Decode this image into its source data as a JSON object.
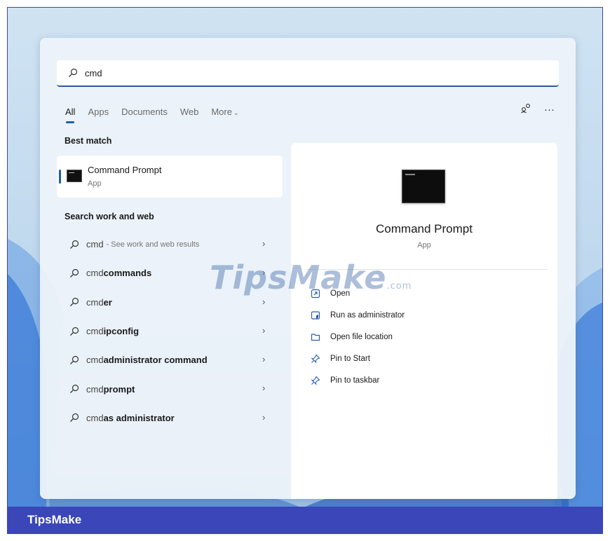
{
  "search": {
    "query": "cmd"
  },
  "tabs": [
    {
      "label": "All"
    },
    {
      "label": "Apps"
    },
    {
      "label": "Documents"
    },
    {
      "label": "Web"
    },
    {
      "label": "More"
    }
  ],
  "top_icons": {
    "share": "share-icon",
    "more": "···"
  },
  "best_match": {
    "heading": "Best match",
    "title": "Command Prompt",
    "subtitle": "App"
  },
  "search_web": {
    "heading": "Search work and web",
    "results": [
      {
        "plain": "cmd",
        "bold": "",
        "hint": "- See work and web results"
      },
      {
        "plain": "cmd ",
        "bold": "commands",
        "hint": ""
      },
      {
        "plain": "cmd",
        "bold": "er",
        "hint": ""
      },
      {
        "plain": "cmd ",
        "bold": "ipconfig",
        "hint": ""
      },
      {
        "plain": "cmd ",
        "bold": "administrator command",
        "hint": ""
      },
      {
        "plain": "cmd ",
        "bold": "prompt",
        "hint": ""
      },
      {
        "plain": "cmd ",
        "bold": "as administrator",
        "hint": ""
      }
    ]
  },
  "preview": {
    "title": "Command Prompt",
    "subtitle": "App",
    "actions": [
      {
        "label": "Open",
        "icon": "open-icon"
      },
      {
        "label": "Run as administrator",
        "icon": "shield-icon"
      },
      {
        "label": "Open file location",
        "icon": "folder-icon"
      },
      {
        "label": "Pin to Start",
        "icon": "pin-icon"
      },
      {
        "label": "Pin to taskbar",
        "icon": "pin-icon"
      }
    ]
  },
  "watermark": {
    "text": "TipsMake",
    "suffix": ".com"
  },
  "footer": {
    "brand": "TipsMake"
  },
  "colors": {
    "accent": "#1f5fa8",
    "footer": "#3b46b8"
  }
}
